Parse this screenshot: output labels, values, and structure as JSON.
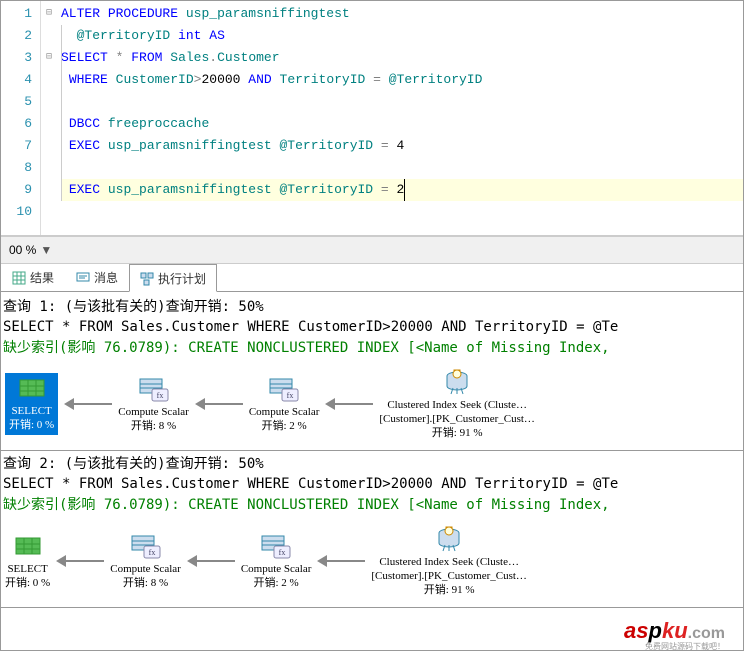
{
  "editor": {
    "lines": [
      {
        "n": "1",
        "fold": "⊟",
        "tokens": [
          {
            "c": "kw",
            "t": "ALTER"
          },
          {
            "c": "txt",
            "t": " "
          },
          {
            "c": "kw",
            "t": "PROCEDURE"
          },
          {
            "c": "txt",
            "t": " "
          },
          {
            "c": "ident",
            "t": "usp_paramsniffingtest"
          }
        ]
      },
      {
        "n": "2",
        "fold": "",
        "tokens": [
          {
            "c": "txt",
            "t": "  "
          },
          {
            "c": "ident",
            "t": "@TerritoryID"
          },
          {
            "c": "txt",
            "t": " "
          },
          {
            "c": "kw",
            "t": "int"
          },
          {
            "c": "txt",
            "t": " "
          },
          {
            "c": "kw",
            "t": "AS"
          }
        ]
      },
      {
        "n": "3",
        "fold": "⊟",
        "tokens": [
          {
            "c": "kw",
            "t": "SELECT"
          },
          {
            "c": "txt",
            "t": " "
          },
          {
            "c": "op",
            "t": "*"
          },
          {
            "c": "txt",
            "t": " "
          },
          {
            "c": "kw",
            "t": "FROM"
          },
          {
            "c": "txt",
            "t": " "
          },
          {
            "c": "ident",
            "t": "Sales"
          },
          {
            "c": "op",
            "t": "."
          },
          {
            "c": "ident",
            "t": "Customer"
          }
        ]
      },
      {
        "n": "4",
        "fold": "",
        "tokens": [
          {
            "c": "txt",
            "t": " "
          },
          {
            "c": "kw",
            "t": "WHERE"
          },
          {
            "c": "txt",
            "t": " "
          },
          {
            "c": "ident",
            "t": "CustomerID"
          },
          {
            "c": "op",
            "t": ">"
          },
          {
            "c": "num",
            "t": "20000"
          },
          {
            "c": "txt",
            "t": " "
          },
          {
            "c": "kw",
            "t": "AND"
          },
          {
            "c": "txt",
            "t": " "
          },
          {
            "c": "ident",
            "t": "TerritoryID"
          },
          {
            "c": "txt",
            "t": " "
          },
          {
            "c": "op",
            "t": "="
          },
          {
            "c": "txt",
            "t": " "
          },
          {
            "c": "ident",
            "t": "@TerritoryID"
          }
        ]
      },
      {
        "n": "5",
        "fold": "",
        "tokens": []
      },
      {
        "n": "6",
        "fold": "",
        "tokens": [
          {
            "c": "txt",
            "t": " "
          },
          {
            "c": "kw",
            "t": "DBCC"
          },
          {
            "c": "txt",
            "t": " "
          },
          {
            "c": "ident",
            "t": "freeproccache"
          }
        ]
      },
      {
        "n": "7",
        "fold": "",
        "tokens": [
          {
            "c": "txt",
            "t": " "
          },
          {
            "c": "kw",
            "t": "EXEC"
          },
          {
            "c": "txt",
            "t": " "
          },
          {
            "c": "ident",
            "t": "usp_paramsniffingtest"
          },
          {
            "c": "txt",
            "t": " "
          },
          {
            "c": "ident",
            "t": "@TerritoryID"
          },
          {
            "c": "txt",
            "t": " "
          },
          {
            "c": "op",
            "t": "="
          },
          {
            "c": "txt",
            "t": " "
          },
          {
            "c": "num",
            "t": "4"
          }
        ]
      },
      {
        "n": "8",
        "fold": "",
        "tokens": []
      },
      {
        "n": "9",
        "fold": "",
        "tokens": [
          {
            "c": "txt",
            "t": " "
          },
          {
            "c": "kw",
            "t": "EXEC"
          },
          {
            "c": "txt",
            "t": " "
          },
          {
            "c": "ident",
            "t": "usp_paramsniffingtest"
          },
          {
            "c": "txt",
            "t": " "
          },
          {
            "c": "ident",
            "t": "@TerritoryID"
          },
          {
            "c": "txt",
            "t": " "
          },
          {
            "c": "op",
            "t": "="
          },
          {
            "c": "txt",
            "t": " "
          },
          {
            "c": "num",
            "t": "2"
          }
        ],
        "caret": true,
        "hl": true
      },
      {
        "n": "10",
        "fold": "",
        "tokens": []
      }
    ]
  },
  "zoom": {
    "value": "00 %"
  },
  "tabs": {
    "results": "结果",
    "messages": "消息",
    "plan": "执行计划",
    "active": "执行计划"
  },
  "queries": [
    {
      "header": "查询 1: (与该批有关的)查询开销: 50%",
      "sql": "SELECT * FROM Sales.Customer WHERE CustomerID>20000 AND TerritoryID = @Te",
      "hint": "缺少索引(影响 76.0789): CREATE NONCLUSTERED INDEX [<Name of Missing Index,",
      "nodes": [
        {
          "title": "SELECT",
          "cost": "开销: 0 %",
          "icon": "select",
          "selected": true
        },
        {
          "title": "Compute Scalar",
          "cost": "开销: 8 %",
          "icon": "compute"
        },
        {
          "title": "Compute Scalar",
          "cost": "开销: 2 %",
          "icon": "compute"
        },
        {
          "title": "Clustered Index Seek (Cluste…",
          "sub": "[Customer].[PK_Customer_Cust…",
          "cost": "开销: 91 %",
          "icon": "seek"
        }
      ]
    },
    {
      "header": "查询 2: (与该批有关的)查询开销: 50%",
      "sql": "SELECT * FROM Sales.Customer WHERE CustomerID>20000 AND TerritoryID = @Te",
      "hint": "缺少索引(影响 76.0789): CREATE NONCLUSTERED INDEX [<Name of Missing Index,",
      "nodes": [
        {
          "title": "SELECT",
          "cost": "开销: 0 %",
          "icon": "select"
        },
        {
          "title": "Compute Scalar",
          "cost": "开销: 8 %",
          "icon": "compute"
        },
        {
          "title": "Compute Scalar",
          "cost": "开销: 2 %",
          "icon": "compute"
        },
        {
          "title": "Clustered Index Seek (Cluste…",
          "sub": "[Customer].[PK_Customer_Cust…",
          "cost": "开销: 91 %",
          "icon": "seek"
        }
      ]
    }
  ],
  "watermark": {
    "text": "aspku",
    "suffix": ".com",
    "sub": "免费网站源码下载吧！"
  }
}
